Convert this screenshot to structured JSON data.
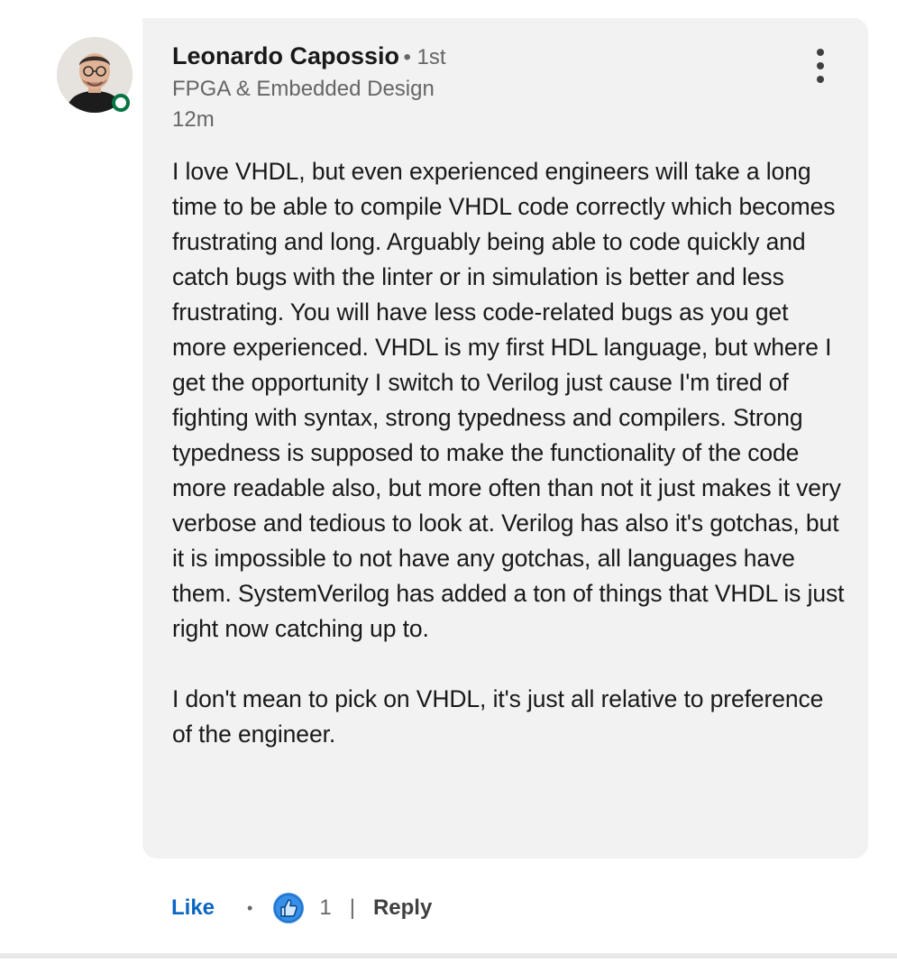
{
  "comment": {
    "author_name": "Leonardo Capossio",
    "degree": "• 1st",
    "headline": "FPGA & Embedded Design",
    "timestamp": "12m",
    "paragraphs": [
      "I love VHDL, but even experienced engineers will take a long time to be able to compile VHDL code correctly which becomes frustrating and long. Arguably being able to code quickly and catch bugs with the linter or in simulation is better and less frustrating. You will have less code-related bugs as you get more experienced. VHDL is my first HDL language, but where I get the opportunity I switch to Verilog just cause I'm tired of fighting with syntax, strong typedness and compilers. Strong typedness is supposed to make the functionality of the code more readable also, but more often than not it just makes it very verbose and tedious to look at. Verilog has also it's gotchas, but it is impossible to not have any gotchas, all languages have them. SystemVerilog has added a ton of things that VHDL is just right now catching up to.",
      "I don't mean to pick on VHDL, it's just all relative to preference of the engineer."
    ]
  },
  "actions": {
    "like_label": "Like",
    "dot": "•",
    "reaction_icon": "thumbs-up-icon",
    "reaction_count": "1",
    "separator": "|",
    "reply_label": "Reply"
  },
  "icons": {
    "more": "vertical-ellipsis-icon",
    "presence": "online-status-icon"
  },
  "colors": {
    "bubble_background": "#f2f2f2",
    "link_blue": "#0a66c2",
    "presence_green": "#057642",
    "secondary_text": "#666666"
  }
}
